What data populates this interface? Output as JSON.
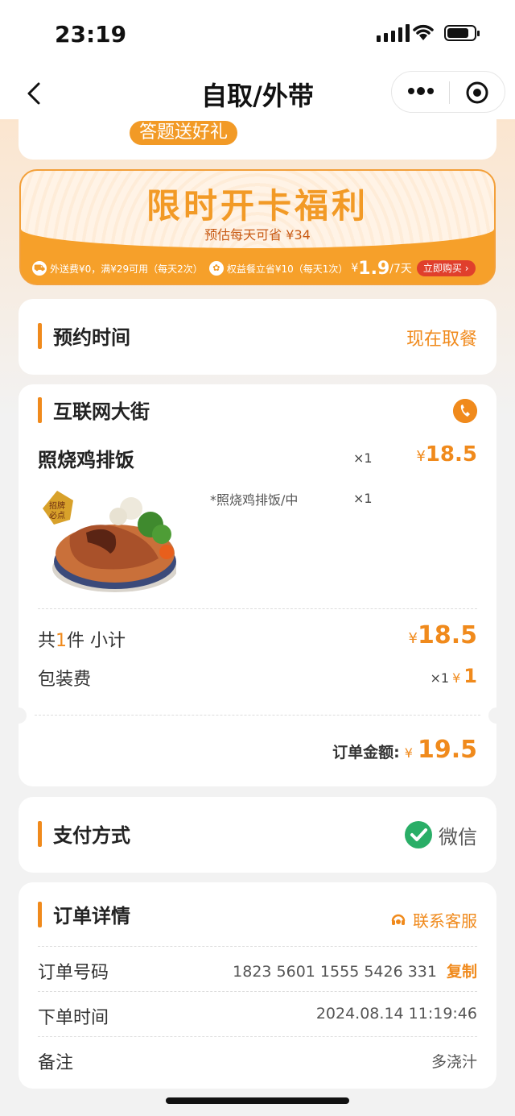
{
  "status_bar": {
    "time": "23:19"
  },
  "nav": {
    "title": "自取/外带"
  },
  "top_card": {
    "quiz_label": "答题送好礼"
  },
  "promo": {
    "title": "限时开卡福利",
    "subtitle": "预估每天可省 ¥34",
    "benefit1": "外送费¥0，满¥29可用（每天2次）",
    "benefit2": "权益餐立省¥10（每天1次）",
    "price_symbol": "¥",
    "price": "1.9",
    "period": "/7天",
    "buy_label": "立即购买 ›"
  },
  "reservation": {
    "label": "预约时间",
    "value": "现在取餐"
  },
  "store": {
    "name": "互联网大街",
    "item": {
      "name": "照烧鸡排饭",
      "qty": "×1",
      "price": "18.5",
      "spec": "*照烧鸡排饭/中",
      "spec_qty": "×1",
      "badge": "招牌必点"
    },
    "subtotal_prefix": "共",
    "subtotal_count": "1",
    "subtotal_suffix": "件 小计",
    "subtotal": "18.5",
    "packaging_label": "包装费",
    "packaging_qty": "×1",
    "packaging_price": "1",
    "order_total_label": "订单金额:",
    "order_total": "19.5",
    "currency": "¥"
  },
  "payment": {
    "label": "支付方式",
    "method": "微信"
  },
  "order_detail": {
    "label": "订单详情",
    "cs_label": "联系客服",
    "rows": [
      {
        "key": "订单号码",
        "value": "1823 5601 1555 5426 331",
        "action": "复制"
      },
      {
        "key": "下单时间",
        "value": "2024.08.14 11:19:46"
      },
      {
        "key": "备注",
        "value": "多浇汁"
      }
    ]
  },
  "colors": {
    "accent": "#f08a1c",
    "promo": "#f6a02a",
    "wechat": "#2aae67"
  }
}
